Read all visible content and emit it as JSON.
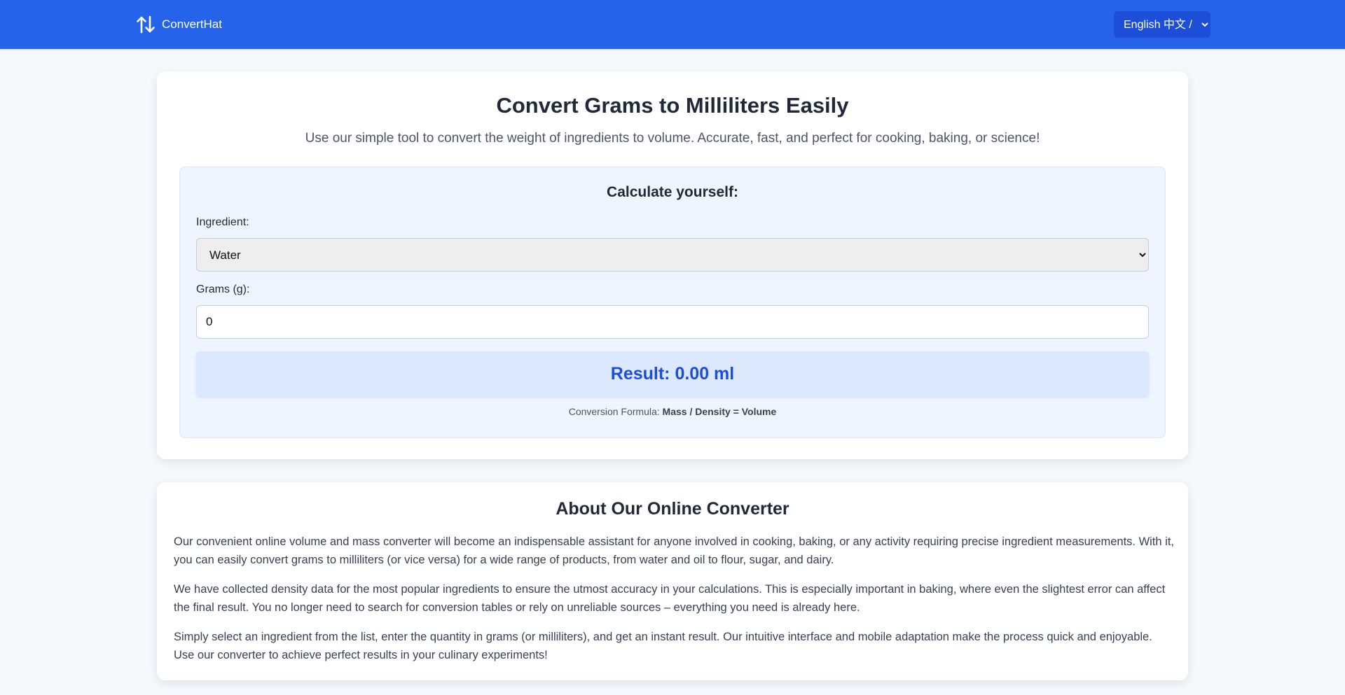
{
  "header": {
    "brand_name": "ConvertHat",
    "brand_icon": "arrows-up-down-icon",
    "language_selected": "English 中文 / 🇬🇧",
    "colors": {
      "bar": "#2563eb",
      "lang_select": "#1d4ed8"
    }
  },
  "hero": {
    "title": "Convert Grams to Milliliters Easily",
    "subtitle": "Use our simple tool to convert the weight of ingredients to volume. Accurate, fast, and perfect for cooking, baking, or science!"
  },
  "calculator": {
    "title": "Calculate yourself:",
    "ingredient_label": "Ingredient:",
    "ingredient_selected": "Water",
    "grams_label": "Grams (g):",
    "grams_value": "0",
    "result_text": "Result: 0.00 ml",
    "formula_prefix": "Conversion Formula:",
    "formula_text": "Mass / Density = Volume",
    "colors": {
      "result_text": "#1d4ed8",
      "result_bg": "#dbe8fe",
      "panel_bg": "#eef5ff"
    }
  },
  "about": {
    "title": "About Our Online Converter",
    "paragraphs": [
      "Our convenient online volume and mass converter will become an indispensable assistant for anyone involved in cooking, baking, or any activity requiring precise ingredient measurements. With it, you can easily convert grams to milliliters (or vice versa) for a wide range of products, from water and oil to flour, sugar, and dairy.",
      "We have collected density data for the most popular ingredients to ensure the utmost accuracy in your calculations. This is especially important in baking, where even the slightest error can affect the final result. You no longer need to search for conversion tables or rely on unreliable sources – everything you need is already here.",
      "Simply select an ingredient from the list, enter the quantity in grams (or milliliters), and get an instant result. Our intuitive interface and mobile adaptation make the process quick and enjoyable. Use our converter to achieve perfect results in your culinary experiments!"
    ]
  }
}
